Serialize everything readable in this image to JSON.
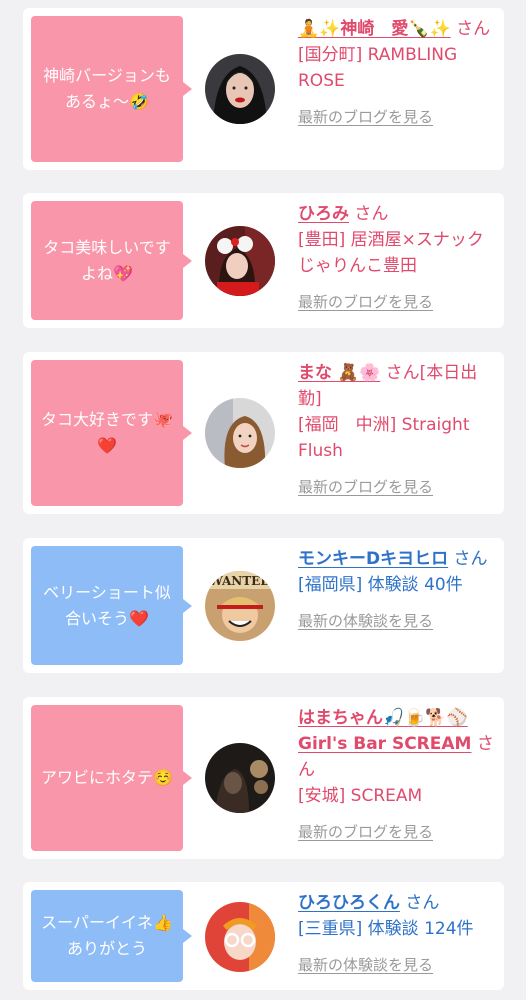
{
  "cards": [
    {
      "comment_line1": "神崎バージョンも",
      "comment_line2": "あるょ〜🤣",
      "name": "🧘✨神崎　愛🍾✨",
      "suffix": "さん",
      "shop": "[国分町] RAMBLING ROSE",
      "link_label": "最新のブログを見る"
    },
    {
      "comment_line1": "タコ美味しいです",
      "comment_line2": "よね💖",
      "name": "ひろみ",
      "suffix": "さん",
      "shop": "[豊田] 居酒屋×スナック じゃりんこ豊田",
      "link_label": "最新のブログを見る"
    },
    {
      "comment_line1": "タコ大好きです🐙",
      "comment_line2": "❤️",
      "name": "まな 🧸🌸",
      "suffix": "さん[本日出勤]",
      "shop": "[福岡　中洲] Straight Flush",
      "link_label": "最新のブログを見る"
    },
    {
      "comment_line1": "ベリーショート似",
      "comment_line2": "合いそう❤️",
      "name": "モンキーDキヨヒロ",
      "suffix": "さん",
      "shop": "[福岡県] 体験談 40件",
      "link_label": "最新の体験談を見る"
    },
    {
      "comment_line1": "アワビにホタテ☺️",
      "comment_line2": "",
      "name": "はまちゃん🎣🍺🐕⚾ Girl's Bar SCREAM",
      "suffix": "さん",
      "shop": "[安城] SCREAM",
      "link_label": "最新のブログを見る"
    },
    {
      "comment_line1": "スーパーイイネ👍",
      "comment_line2": "ありがとう",
      "name": "ひろひろくん",
      "suffix": "さん",
      "shop": "[三重県] 体験談 124件",
      "link_label": "最新の体験談を見る"
    }
  ],
  "colors": {
    "pink_bubble": "#f996aa",
    "blue_bubble": "#8ebcf7",
    "pink_text": "#e04a6c",
    "blue_text": "#2e72c9",
    "link_gray": "#9a9a9a"
  }
}
